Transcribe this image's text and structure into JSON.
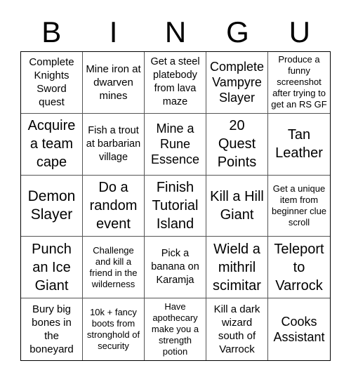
{
  "header": {
    "letters": [
      "B",
      "I",
      "N",
      "G",
      "U"
    ]
  },
  "cells": [
    "Complete Knights Sword quest",
    "Mine iron at dwarven mines",
    "Get a steel platebody from lava maze",
    "Complete Vampyre Slayer",
    "Produce a funny screenshot after trying to get an RS GF",
    "Acquire a team cape",
    "Fish a trout at barbarian village",
    "Mine a Rune Essence",
    "20 Quest Points",
    "Tan Leather",
    "Demon Slayer",
    "Do a random event",
    "Finish Tutorial Island",
    "Kill a Hill Giant",
    "Get a unique item from beginner clue scroll",
    "Punch an Ice Giant",
    "Challenge and kill a friend in the wilderness",
    "Pick a banana on Karamja",
    "Wield a mithril scimitar",
    "Teleport to Varrock",
    "Bury big bones in the boneyard",
    "10k + fancy boots from stronghold of security",
    "Have apothecary make you a strength potion",
    "Kill a dark wizard south of Varrock",
    "Cooks Assistant"
  ]
}
